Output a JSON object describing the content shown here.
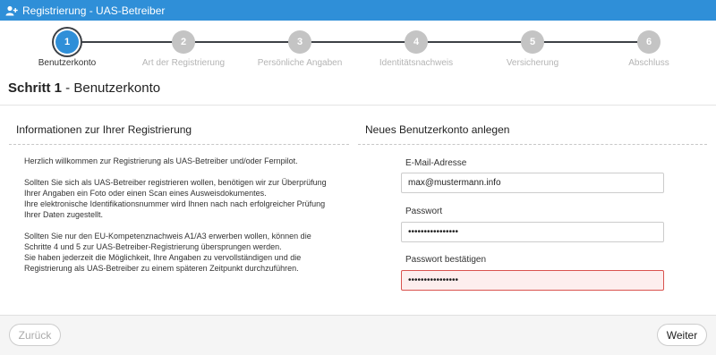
{
  "window": {
    "title": "Registrierung - UAS-Betreiber"
  },
  "stepper": {
    "steps": [
      {
        "number": "1",
        "label": "Benutzerkonto",
        "active": true
      },
      {
        "number": "2",
        "label": "Art der Registrierung",
        "active": false
      },
      {
        "number": "3",
        "label": "Persönliche Angaben",
        "active": false
      },
      {
        "number": "4",
        "label": "Identitätsnachweis",
        "active": false
      },
      {
        "number": "5",
        "label": "Versicherung",
        "active": false
      },
      {
        "number": "6",
        "label": "Abschluss",
        "active": false
      }
    ]
  },
  "page": {
    "title_bold": "Schritt 1",
    "title_rest": " - Benutzerkonto"
  },
  "info_section": {
    "heading": "Informationen zur Ihrer Registrierung",
    "paragraphs": [
      "Herzlich willkommen zur Registrierung als UAS-Betreiber und/oder Fernpilot.",
      "Sollten Sie sich als UAS-Betreiber registrieren wollen, benötigen wir zur Überprüfung Ihrer Angaben ein Foto oder einen Scan eines Ausweisdokumentes.\nIhre elektronische Identifikationsnummer wird Ihnen nach nach erfolgreicher Prüfung Ihrer Daten zugestellt.",
      "Sollten Sie nur den EU-Kompetenznachweis A1/A3 erwerben wollen, können die Schritte 4 und 5 zur UAS-Betreiber-Registrierung übersprungen werden.\nSie haben jederzeit die Möglichkeit, Ihre Angaben zu vervollständigen und die Registrierung als UAS-Betreiber zu einem späteren Zeitpunkt durchzuführen."
    ]
  },
  "account_section": {
    "heading": "Neues Benutzerkonto anlegen",
    "email_label": "E-Mail-Adresse",
    "email_value": "max@mustermann.info",
    "password_label": "Passwort",
    "password_value": "••••••••••••••••",
    "password_confirm_label": "Passwort bestätigen",
    "password_confirm_value": "••••••••••••••••"
  },
  "footer": {
    "back_label": "Zurück",
    "next_label": "Weiter"
  },
  "colors": {
    "accent": "#2f8fd8",
    "error_border": "#d9534f",
    "error_bg": "#fdeeee"
  }
}
